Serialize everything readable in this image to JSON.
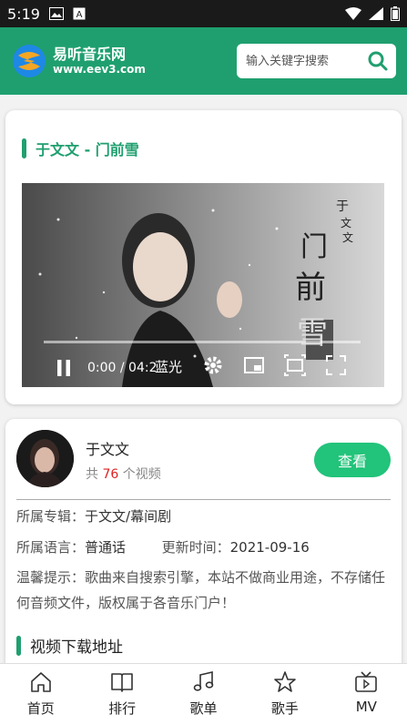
{
  "status_bar": {
    "time": "5:19",
    "icons_left": [
      "image-icon",
      "a-square-icon"
    ],
    "icons_right": [
      "wifi-icon",
      "signal-icon",
      "battery-icon"
    ]
  },
  "header": {
    "logo_title": "易听音乐网",
    "logo_domain": "www.eev3.com",
    "search_placeholder": "输入关键字搜索",
    "brand_color": "#1f9f6f"
  },
  "video": {
    "title": "于文文 - 门前雪",
    "player": {
      "time": "0:00 / 04:2",
      "quality": "蓝光",
      "progress": 0
    }
  },
  "artist": {
    "name": "于文文",
    "count_prefix": "共",
    "count": "76",
    "count_suffix": "个视频",
    "view_label": "查看"
  },
  "info": {
    "album_label": "所属专辑：",
    "album_value": "于文文/幕间剧",
    "language_label": "所属语言：",
    "language_value": "普通话",
    "update_label": "更新时间：",
    "update_value": "2021-09-16",
    "notice": "温馨提示：歌曲来自搜索引擎，本站不做商业用途，不存储任何音频文件，版权属于各音乐门户！"
  },
  "download": {
    "title": "视频下载地址"
  },
  "nav": [
    {
      "label": "首页",
      "icon": "home-icon"
    },
    {
      "label": "排行",
      "icon": "book-icon"
    },
    {
      "label": "歌单",
      "icon": "music-note-icon"
    },
    {
      "label": "歌手",
      "icon": "star-icon"
    },
    {
      "label": "MV",
      "icon": "tv-icon"
    }
  ]
}
